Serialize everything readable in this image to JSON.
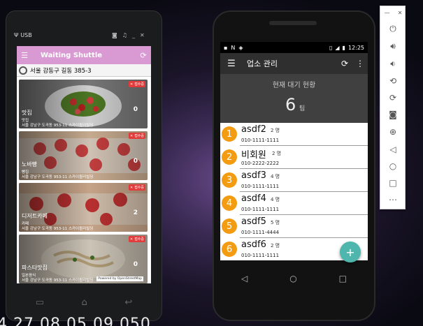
{
  "left_app": {
    "usb_label": "USB",
    "app_title": "Waiting Shuttle",
    "address": "서울 강동구 길동 385-3",
    "cards": [
      {
        "name": "맛집",
        "category": "맛집",
        "address": "서울 강남구 도곡동 953-11 스카이퀄리빌딩",
        "count": "0",
        "badge": "접수중"
      },
      {
        "name": "노바빵",
        "category": "빵집",
        "address": "서울 강남구 도곡동 953-11 스카이퀄리빌딩",
        "count": "0",
        "badge": "접수중"
      },
      {
        "name": "디저트카페",
        "category": "카페",
        "address": "서울 강남구 도곡동 953-11 스카이퀄리빌딩",
        "count": "2",
        "badge": "접수중"
      },
      {
        "name": "파스타맛집",
        "category": "일본음식",
        "address": "서울 강남구 도곡동 953-11 스카이퀄리빌딩",
        "count": "0",
        "badge": "접수중"
      }
    ],
    "powered_by": "Powered by OpenStreetMap"
  },
  "right_app": {
    "status_time": "12:25",
    "app_title": "업소 관리",
    "header_label": "현재 대기 현황",
    "wait_count": "6",
    "wait_unit": "팀",
    "queue": [
      {
        "number": "1",
        "name": "asdf2",
        "people": "2 명",
        "phone": "010-1111-1111"
      },
      {
        "number": "2",
        "name": "비회원",
        "people": "2 명",
        "phone": "010-2222-2222"
      },
      {
        "number": "3",
        "name": "asdf3",
        "people": "4 명",
        "phone": "010-1111-1111"
      },
      {
        "number": "4",
        "name": "asdf4",
        "people": "4 명",
        "phone": "010-1111-1111"
      },
      {
        "number": "5",
        "name": "asdf5",
        "people": "5 명",
        "phone": "010-1111-4444"
      },
      {
        "number": "6",
        "name": "asdf6",
        "people": "2 명",
        "phone": "010-1111-1111"
      }
    ],
    "fab_label": "+"
  },
  "bottom_text": "4 27 08 05 09 050",
  "colors": {
    "left_appbar": "#d99ad4",
    "right_appbar": "#2f2f2f",
    "queue_circle": "#f39c12",
    "fab": "#4fb6ad",
    "badge": "#e23b3b"
  }
}
